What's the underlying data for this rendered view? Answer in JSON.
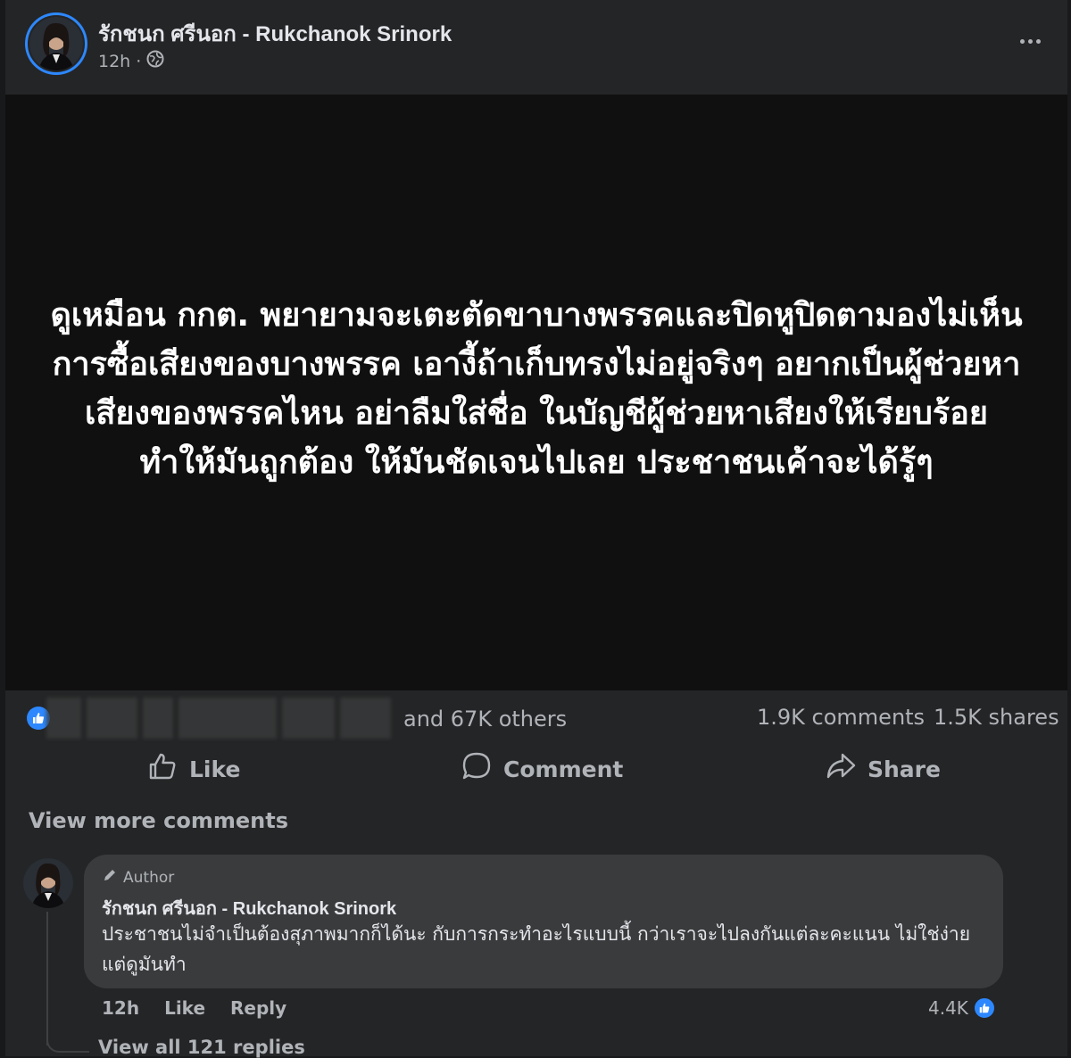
{
  "post": {
    "author_name": "รักชนก ศรีนอก - Rukchanok Srinork",
    "time": "12h",
    "separator": "·",
    "text": "ดูเหมือน กกต. พยายามจะเตะตัดขาบางพรรคและปิดหูปิดตามองไม่เห็นการซื้อเสียงของบางพรรค เอางี้ถ้าเก็บทรงไม่อยู่จริงๆ อยากเป็นผู้ช่วยหาเสียงของพรรคไหน อย่าลืมใส่ชื่อ ในบัญชีผู้ช่วยหาเสียงให้เรียบร้อย ทำให้มันถูกต้อง ให้มันชัดเจนไปเลย ประชาชนเค้าจะได้รู้ๆ"
  },
  "stats": {
    "reactions_text": "and 67K others",
    "comments": "1.9K comments",
    "shares": "1.5K shares"
  },
  "actions": {
    "like": "Like",
    "comment": "Comment",
    "share": "Share"
  },
  "view_more_comments": "View more comments",
  "comment": {
    "author_tag": "Author",
    "name": "รักชนก ศรีนอก - Rukchanok Srinork",
    "text": "ประชาชนไม่จำเป็นต้องสุภาพมากก็ได้นะ กับการกระทำอะไรแบบนี้ กว่าเราจะไปลงกันแต่ละคะแนน ไม่ใช่ง่าย แต่ดูมันทำ",
    "time": "12h",
    "like": "Like",
    "reply": "Reply",
    "reaction_count": "4.4K",
    "view_replies": "View all 121 replies"
  },
  "colors": {
    "background": "#18191a",
    "card": "#242526",
    "accent": "#2d88ff",
    "secondary_text": "#b0b3b8"
  },
  "icons": [
    "globe-icon",
    "more-options-icon",
    "like-reaction-icon",
    "thumbs-up-icon",
    "comment-icon",
    "share-icon",
    "pencil-icon"
  ]
}
